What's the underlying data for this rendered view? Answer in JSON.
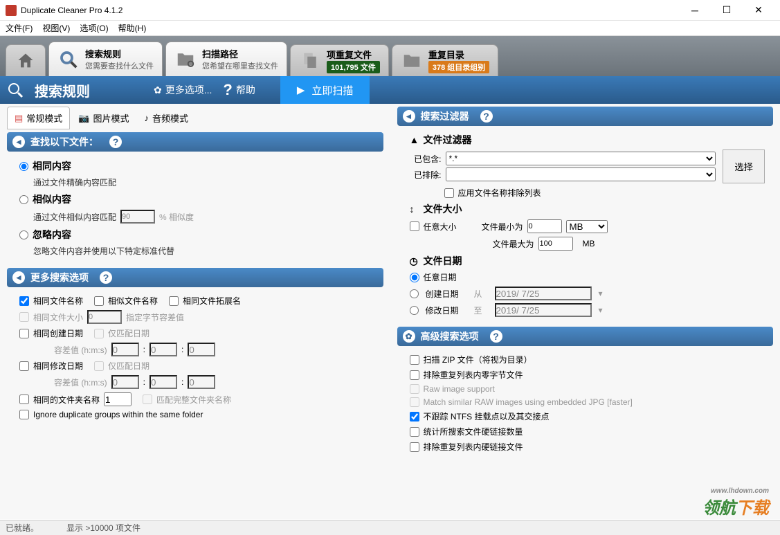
{
  "window": {
    "title": "Duplicate Cleaner Pro 4.1.2"
  },
  "menu": {
    "file": "文件(F)",
    "view": "视图(V)",
    "options": "选项(O)",
    "help": "帮助(H)"
  },
  "tabs": {
    "search_rules": {
      "title": "搜索规则",
      "sub": "您需要查找什么文件"
    },
    "scan_path": {
      "title": "扫描路径",
      "sub": "您希望在哪里查找文件"
    },
    "dup_files": {
      "title": "项重复文件",
      "badge": "101,795 文件"
    },
    "dup_dirs": {
      "title": "重复目录",
      "badge": "378 组目录组别"
    }
  },
  "toolbar": {
    "title": "搜索规则",
    "more_options": "更多选项...",
    "help": "帮助",
    "scan_now": "立即扫描"
  },
  "modes": {
    "normal": "常规模式",
    "image": "图片模式",
    "audio": "音频模式"
  },
  "find_section": {
    "title": "查找以下文件：",
    "same_content": "相同内容",
    "same_content_desc": "通过文件精确内容匹配",
    "similar_content": "相似内容",
    "similar_content_desc": "通过文件相似内容匹配",
    "similarity_value": "90",
    "similarity_suffix": "% 相似度",
    "ignore_content": "忽略内容",
    "ignore_content_desc": "忽略文件内容并使用以下特定标准代替"
  },
  "more_search": {
    "title": "更多搜索选项",
    "same_name": "相同文件名称",
    "similar_name": "相似文件名称",
    "same_ext": "相同文件拓展名",
    "same_size": "相同文件大小",
    "size_val": "0",
    "size_desc": "指定字节容差值",
    "same_cdate": "相同创建日期",
    "date_only": "仅匹配日期",
    "tolerance_label": "容差值 (h:m:s)",
    "tol_h": "0",
    "tol_m": "0",
    "tol_s": "0",
    "same_mdate": "相同修改日期",
    "same_folder": "相同的文件夹名称",
    "folder_val": "1",
    "match_full_folder": "匹配完整文件夹名称",
    "ignore_groups": "Ignore duplicate groups within the same folder"
  },
  "filters": {
    "title": "搜索过滤器",
    "file_filter": "文件过滤器",
    "included": "已包含:",
    "included_val": "*.*",
    "excluded": "已排除:",
    "excluded_val": "",
    "select_btn": "选择",
    "apply_exclusion": "应用文件名称排除列表",
    "file_size": "文件大小",
    "any_size": "任意大小",
    "min_size_label": "文件最小为",
    "min_size_val": "0",
    "max_size_label": "文件最大为",
    "max_size_val": "100",
    "unit": "MB",
    "file_date": "文件日期",
    "any_date": "任意日期",
    "created_date": "创建日期",
    "from": "从",
    "to": "至",
    "modified_date": "修改日期",
    "date_val": "2019/ 7/25"
  },
  "advanced": {
    "title": "高级搜索选项",
    "scan_zip": "扫描 ZIP 文件（将视为目录）",
    "exclude_zero": "排除重复列表内零字节文件",
    "raw_support": "Raw image support",
    "raw_match": "Match similar RAW images using embedded JPG [faster]",
    "no_ntfs": "不跟踪 NTFS 挂载点以及其交接点",
    "count_hardlinks": "统计所搜索文件硬链接数量",
    "exclude_hardlinks": "排除重复列表内硬链接文件"
  },
  "status": {
    "ready": "已就绪。",
    "display": "显示 >10000 项文件"
  },
  "watermark": {
    "text1": "领航",
    "text2": "下载",
    "url": "www.lhdown.com"
  }
}
